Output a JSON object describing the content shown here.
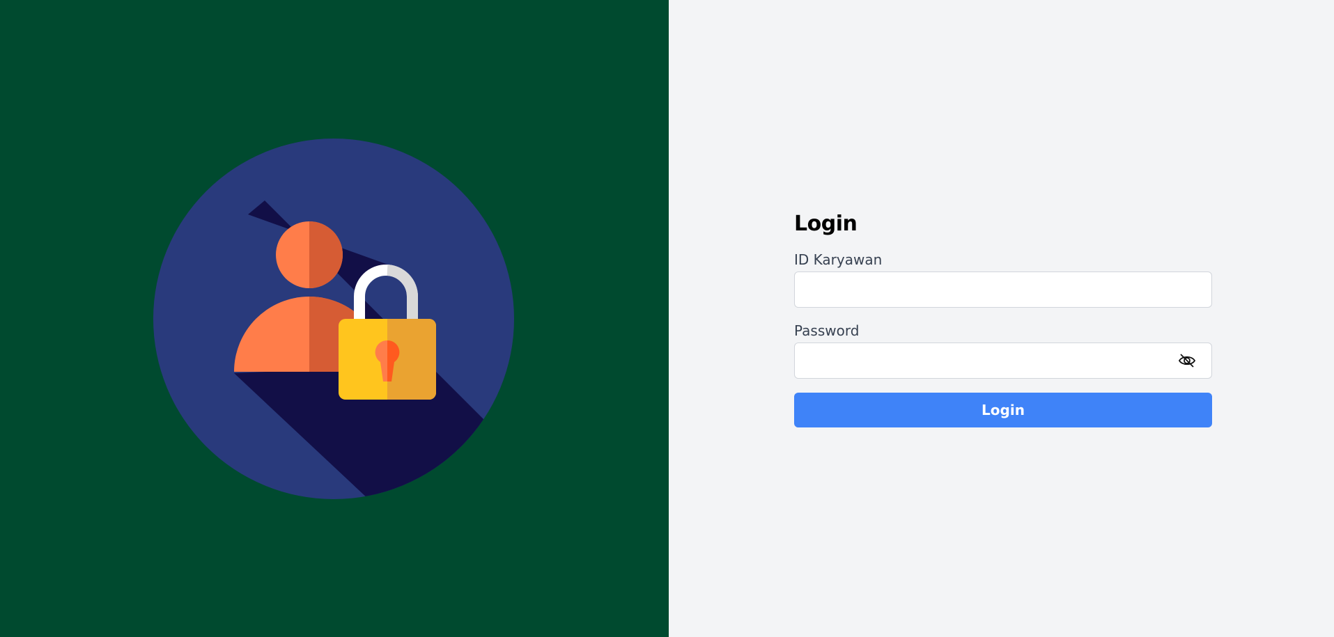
{
  "login": {
    "title": "Login",
    "employee_id_label": "ID Karyawan",
    "employee_id_value": "",
    "password_label": "Password",
    "password_value": "",
    "password_toggle_icon": "eye-slash-icon",
    "submit_label": "Login"
  },
  "illustration": {
    "icon": "user-lock-illustration"
  },
  "colors": {
    "left_background": "#004a2f",
    "right_background": "#f3f4f6",
    "circle": "#293a7c",
    "shadow": "#120f47",
    "person_light": "#ff7d4a",
    "person_dark": "#d65c34",
    "lock_body_light": "#ffc51e",
    "lock_body_dark": "#eaa331",
    "shackle_light": "#ffffff",
    "shackle_dark": "#d9d9d9",
    "keyhole": "#ff5a1f",
    "button": "#3f83f8"
  }
}
